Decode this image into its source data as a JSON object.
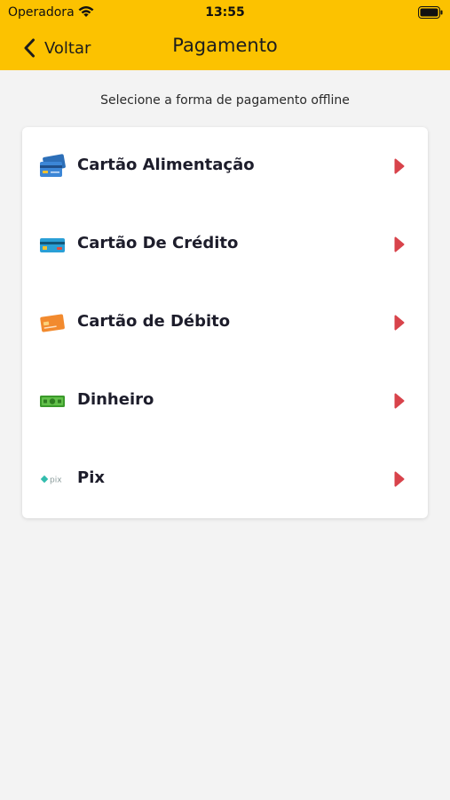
{
  "status_bar": {
    "carrier": "Operadora",
    "time": "13:55"
  },
  "nav": {
    "back_label": "Voltar",
    "title": "Pagamento"
  },
  "subtitle": "Selecione a forma de pagamento offline",
  "payment_options": [
    {
      "label": "Cartão Alimentação",
      "icon": "meal-card-icon"
    },
    {
      "label": "Cartão De Crédito",
      "icon": "credit-card-icon"
    },
    {
      "label": "Cartão de Débito",
      "icon": "debit-card-icon"
    },
    {
      "label": "Dinheiro",
      "icon": "cash-icon"
    },
    {
      "label": "Pix",
      "icon": "pix-icon"
    }
  ],
  "colors": {
    "header": "#fcc200",
    "background": "#f3f3f3",
    "arrow": "#d8434b"
  }
}
